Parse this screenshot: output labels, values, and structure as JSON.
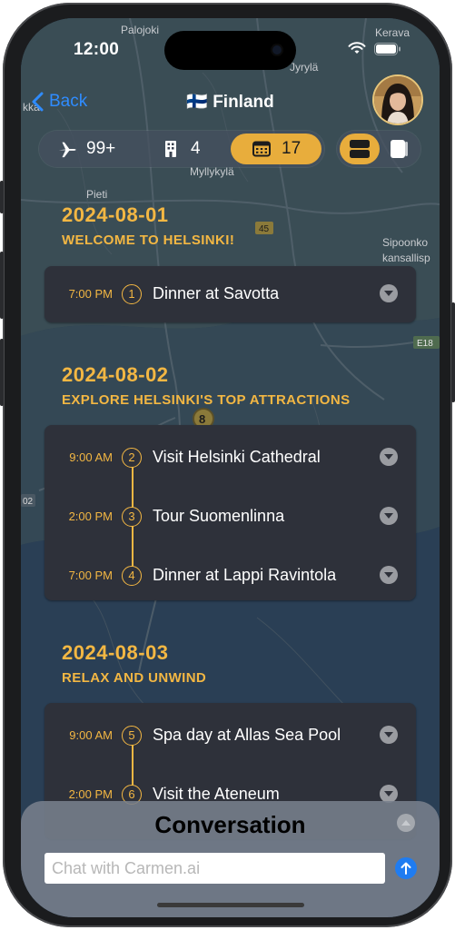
{
  "status_bar": {
    "time": "12:00"
  },
  "header": {
    "back_label": "Back",
    "flag": "🇫🇮",
    "title": "Finland"
  },
  "segment_left": {
    "flights": "99+",
    "hotels": "4",
    "days": "17"
  },
  "map": {
    "labels": [
      "Palojoki",
      "Kerava",
      "Jyrylä",
      "Myllykylä",
      "Pieti",
      "Sipoonko",
      "kansallisp",
      "45",
      "E18",
      "8",
      "02",
      "kka"
    ]
  },
  "itinerary": [
    {
      "date": "2024-08-01",
      "subtitle": "WELCOME TO HELSINKI!",
      "items": [
        {
          "time": "7:00 PM",
          "num": "1",
          "text": "Dinner at Savotta"
        }
      ]
    },
    {
      "date": "2024-08-02",
      "subtitle": "EXPLORE HELSINKI'S TOP ATTRACTIONS",
      "items": [
        {
          "time": "9:00 AM",
          "num": "2",
          "text": "Visit Helsinki Cathedral"
        },
        {
          "time": "2:00 PM",
          "num": "3",
          "text": "Tour Suomenlinna"
        },
        {
          "time": "7:00 PM",
          "num": "4",
          "text": "Dinner at Lappi Ravintola"
        }
      ]
    },
    {
      "date": "2024-08-03",
      "subtitle": "RELAX AND UNWIND",
      "items": [
        {
          "time": "9:00 AM",
          "num": "5",
          "text": "Spa day at Allas Sea Pool"
        },
        {
          "time": "2:00 PM",
          "num": "6",
          "text": "Visit the Ateneum"
        }
      ]
    }
  ],
  "conversation": {
    "title": "Conversation",
    "placeholder": "Chat with Carmen.ai"
  },
  "colors": {
    "accent": "#f3b743",
    "link": "#2f8cff",
    "card": "#2e313a",
    "send": "#1f7cf1"
  }
}
